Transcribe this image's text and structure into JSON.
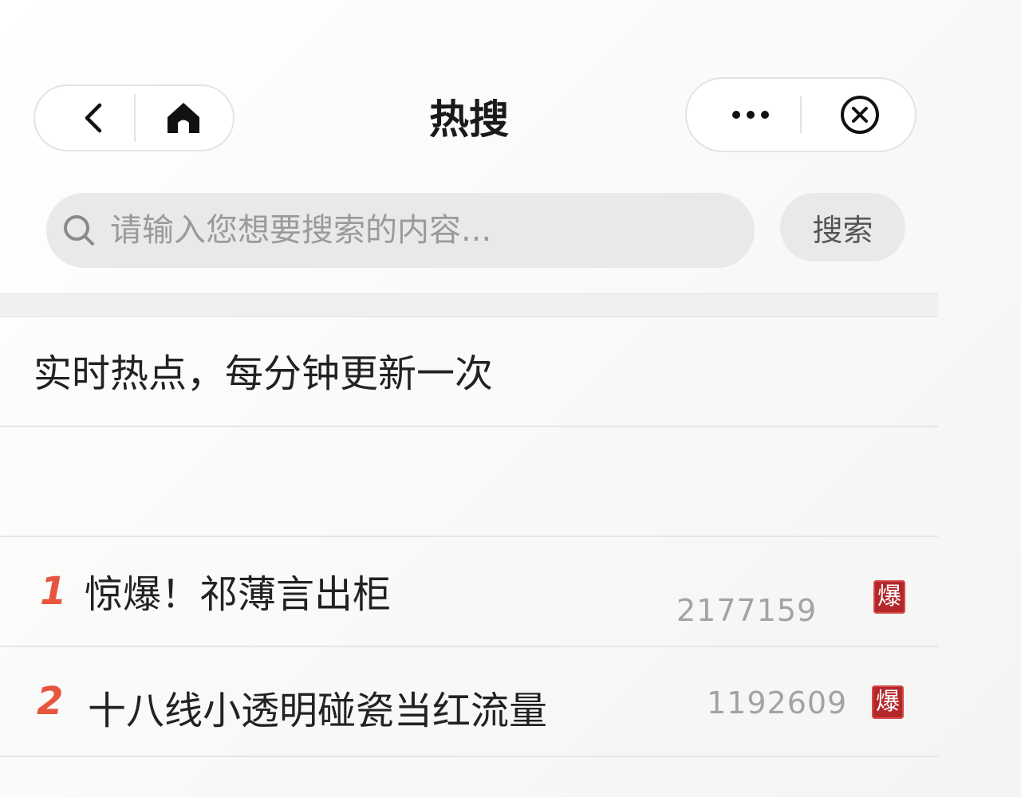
{
  "nav": {
    "title": "热搜",
    "back_icon": "chevron-left-icon",
    "home_icon": "home-icon",
    "more_icon": "more-dots-icon",
    "close_icon": "close-circle-icon"
  },
  "search": {
    "placeholder": "请输入您想要搜索的内容...",
    "value": "",
    "button_label": "搜索",
    "icon": "search-icon"
  },
  "banner": {
    "text": "实时热点，每分钟更新一次"
  },
  "hot_list": [
    {
      "rank": "1",
      "title": "惊爆！祁薄言出柜",
      "count": "2177159",
      "badge": "爆",
      "badge_color": "#b3272a"
    },
    {
      "rank": "2",
      "title": "十八线小透明碰瓷当红流量",
      "count": "1192609",
      "badge": "爆",
      "badge_color": "#b3272a"
    }
  ],
  "colors": {
    "rank_accent": "#e8553f",
    "hot_badge": "#b3272a",
    "search_bg": "#e9e9e9"
  }
}
